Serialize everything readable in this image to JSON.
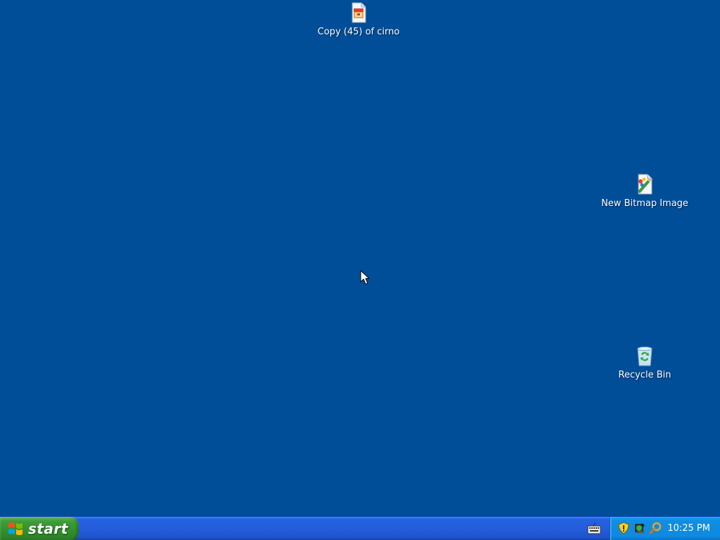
{
  "desktop": {
    "background": "#004e98",
    "icons": [
      {
        "label": "Copy (45) of cirno",
        "icon": "image-file-icon"
      },
      {
        "label": "New Bitmap Image",
        "icon": "bitmap-file-icon"
      },
      {
        "label": "Recycle Bin",
        "icon": "recycle-bin-icon"
      }
    ]
  },
  "taskbar": {
    "start_label": "start",
    "quick_launch": [
      "keyboard-icon"
    ],
    "tray": {
      "icons": [
        "security-shield-icon",
        "app-tray-icon",
        "search-magnifier-icon"
      ],
      "clock": "10:25 PM"
    }
  }
}
